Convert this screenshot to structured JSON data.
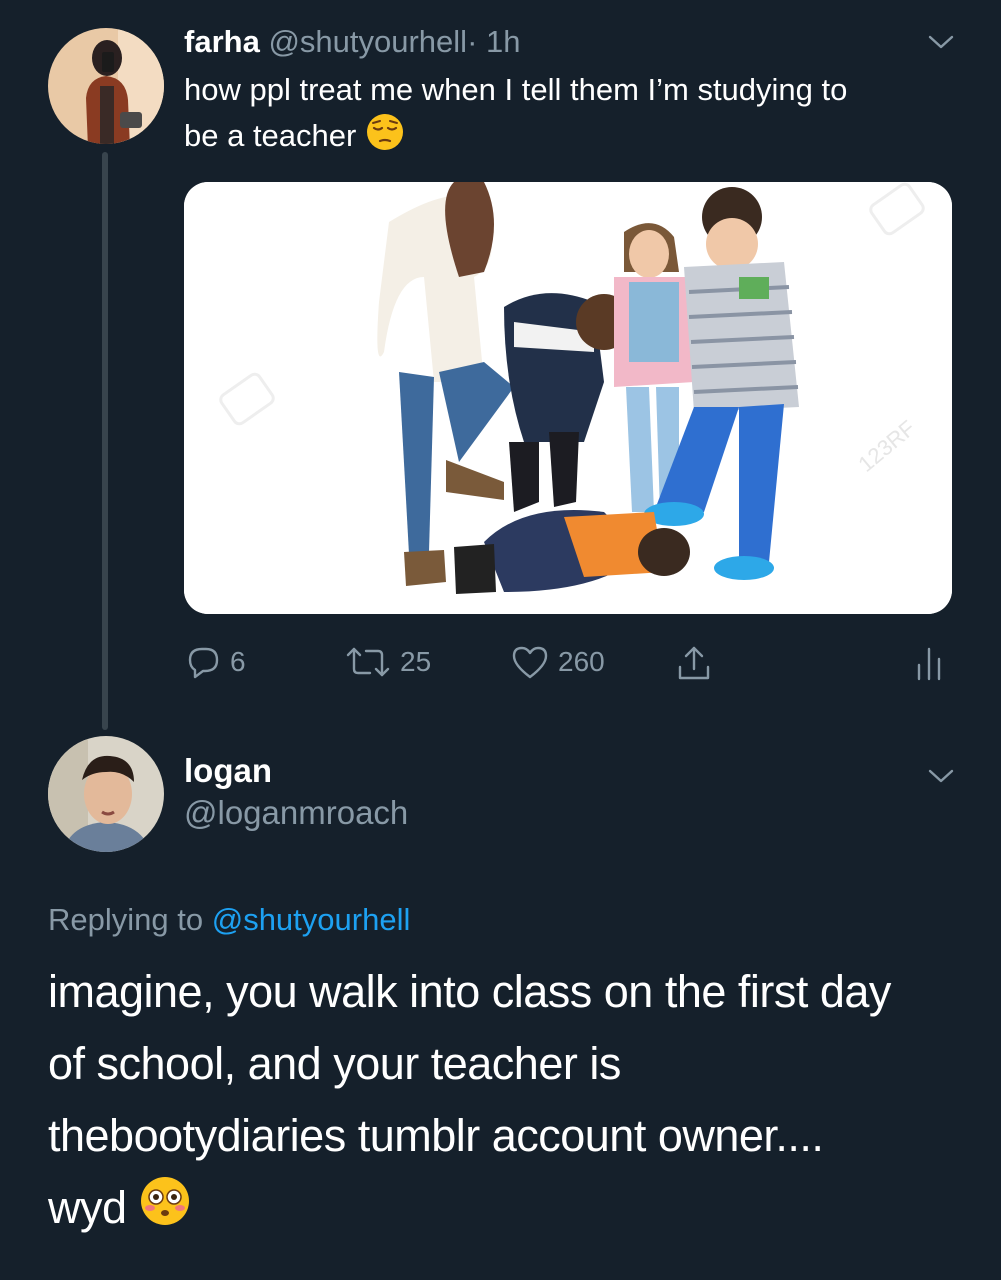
{
  "tweet": {
    "display_name": "farha",
    "handle": "@shutyourhell",
    "separator": "·",
    "time": "1h",
    "text_line1": "how ppl treat me when I tell them I’m studying to",
    "text_line2": "be a teacher",
    "text_emoji": "pensive-face",
    "media": {
      "watermark": "123RF",
      "description_icon": "photo-kids-bullying"
    },
    "actions": {
      "replies": "6",
      "retweets": "25",
      "likes": "260"
    }
  },
  "reply": {
    "display_name": "logan",
    "handle": "@loganmroach",
    "replying_prefix": "Replying to",
    "replying_handle": "@shutyourhell",
    "text_line1": "imagine, you walk into class on the first day",
    "text_line2": "of school, and your teacher is",
    "text_line3": "thebootydiaries tumblr account owner....",
    "text_line4": "wyd",
    "text_emoji": "flushed-face"
  },
  "colors": {
    "background": "#15202b",
    "muted": "#8899a6",
    "link": "#1da1f2",
    "thread_line": "#38444d"
  }
}
